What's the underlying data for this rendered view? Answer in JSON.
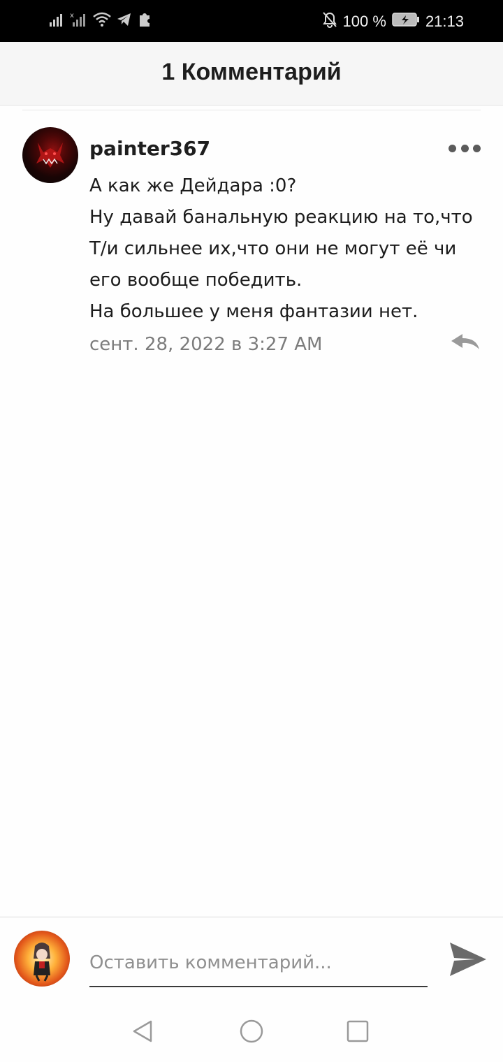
{
  "status_bar": {
    "battery": "100 %",
    "time": "21:13",
    "icons": [
      "signal-icon",
      "signal-no-sim-icon",
      "wifi-icon",
      "telegram-icon",
      "puzzle-icon",
      "bell-off-icon",
      "battery-charging-icon"
    ]
  },
  "header": {
    "title": "1 Комментарий"
  },
  "comment": {
    "author": "painter367",
    "lines": [
      "А как же Дейдара :0?",
      "Ну давай банальную реакцию на то,что",
      "Т/и сильнее их,что они не могут её чи",
      "его вообще победить.",
      "На большее у меня фантазии нет."
    ],
    "timestamp": "сент. 28, 2022 в 3:27 AM",
    "more_icon": "more-dots-icon",
    "reply_icon": "reply-icon"
  },
  "input": {
    "placeholder": "Оставить комментарий...",
    "value": "",
    "send_icon": "send-icon"
  },
  "nav": {
    "icons": [
      "back-icon",
      "home-icon",
      "recents-icon"
    ]
  }
}
